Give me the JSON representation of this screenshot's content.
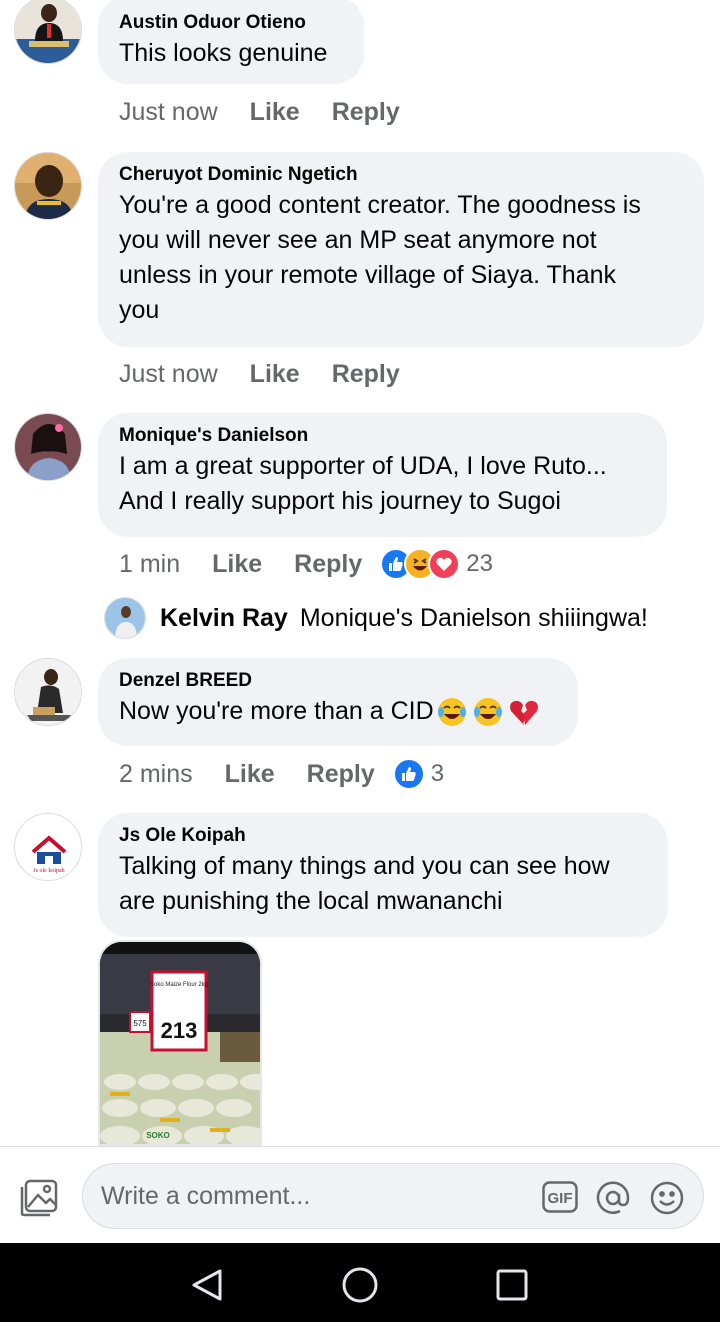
{
  "comments": [
    {
      "author": "Austin Oduor Otieno",
      "text": "This looks genuine",
      "time": "Just now",
      "like": "Like",
      "reply": "Reply"
    },
    {
      "author": "Cheruyot Dominic Ngetich",
      "lines": [
        "You're a good content creator. The goodness is",
        "you will never see an MP seat anymore not",
        "unless in your remote village of Siaya. Thank",
        "you"
      ],
      "time": "Just now",
      "like": "Like",
      "reply": "Reply"
    },
    {
      "author": "Monique's Danielson",
      "lines": [
        "I am  a great supporter of UDA, I love Ruto...",
        "And I really support his journey to Sugoi"
      ],
      "time": "1 min",
      "like": "Like",
      "reply": "Reply",
      "reaction_count": "23"
    },
    {
      "author": "Denzel BREED",
      "text": "Now you're more than a CID",
      "time": "2 mins",
      "like": "Like",
      "reply": "Reply",
      "reaction_count": "3"
    },
    {
      "author": "Js Ole Koipah",
      "lines": [
        "Talking of many things and you can see how",
        "are punishing the local mwananchi"
      ]
    }
  ],
  "reply_preview": {
    "author": "Kelvin Ray",
    "text": "Monique's Danielson  shiiingwa!"
  },
  "photo": {
    "price_tag": "213",
    "side_tag": "575",
    "label": "Soko Maize Flour 2kg",
    "bag_brand": "SOKO"
  },
  "avatars": {
    "koipah_logo_text": "Js ole koipah"
  },
  "composer": {
    "placeholder": "Write a comment...",
    "gif_label": "GIF"
  },
  "colors": {
    "like_blue": "#1877f2",
    "love_red": "#f33e58",
    "haha_yellow": "#f7b125",
    "bubble_gray": "#f0f2f5",
    "meta_gray": "#65676b"
  }
}
